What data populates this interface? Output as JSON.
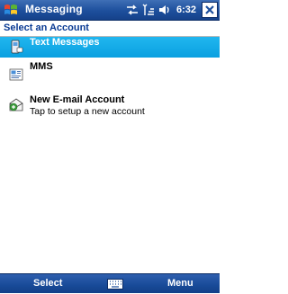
{
  "titlebar": {
    "title": "Messaging",
    "time": "6:32",
    "start_icon": "windows-flag-icon",
    "connectivity_icon": "connectivity-icon",
    "signal_icon": "signal-icon",
    "volume_icon": "speaker-icon",
    "close_icon": "close-icon"
  },
  "header": {
    "title": "Select an Account"
  },
  "accounts": [
    {
      "label": "Text Messages",
      "subtitle": "",
      "icon": "sms-icon",
      "selected": true
    },
    {
      "label": "MMS",
      "subtitle": "",
      "icon": "mms-icon",
      "selected": false
    },
    {
      "label": "New E-mail Account",
      "subtitle": "Tap to setup a new account",
      "icon": "new-email-icon",
      "selected": false
    }
  ],
  "menubar": {
    "left_softkey": "Select",
    "right_softkey": "Menu",
    "keyboard_icon": "keyboard-icon"
  },
  "colors": {
    "titlebar": "#1d4f9c",
    "selection": "#16aaea",
    "header_text": "#0a3b94"
  }
}
